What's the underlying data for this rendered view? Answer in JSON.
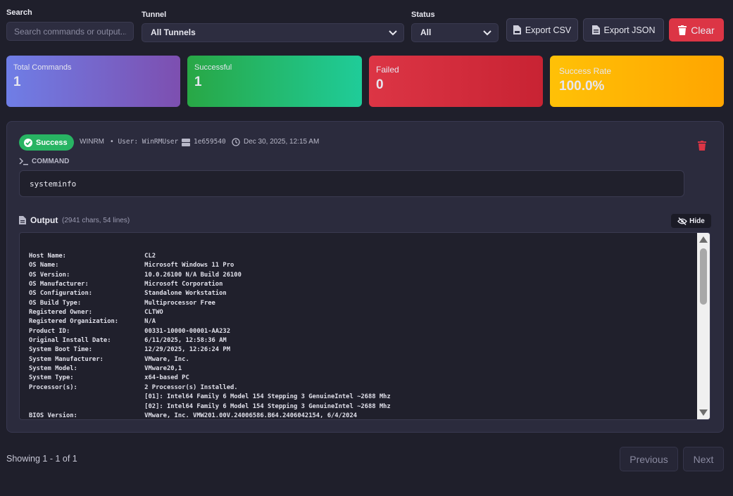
{
  "filters": {
    "search_label": "Search",
    "search_placeholder": "Search commands or output...",
    "tunnel_label": "Tunnel",
    "tunnel_value": "All Tunnels",
    "status_label": "Status",
    "status_value": "All"
  },
  "toolbar": {
    "export_csv": "Export CSV",
    "export_json": "Export JSON",
    "clear": "Clear"
  },
  "stats": [
    {
      "title": "Total Commands",
      "value": "1"
    },
    {
      "title": "Successful",
      "value": "1"
    },
    {
      "title": "Failed",
      "value": "0"
    },
    {
      "title": "Success Rate",
      "value": "100.0%"
    }
  ],
  "entry": {
    "status": "Success",
    "protocol": "WINRM",
    "user": "• User: WinRMUser",
    "tunnel_id": "1e659540",
    "timestamp": "Dec 30, 2025, 12:15 AM",
    "command_label": "COMMAND",
    "command": "systeminfo",
    "output_label": "Output",
    "output_meta": "(2941 chars, 54 lines)",
    "hide_label": "Hide",
    "output_text": "Host Name:                     CL2\nOS Name:                       Microsoft Windows 11 Pro\nOS Version:                    10.0.26100 N/A Build 26100\nOS Manufacturer:               Microsoft Corporation\nOS Configuration:              Standalone Workstation\nOS Build Type:                 Multiprocessor Free\nRegistered Owner:              CLTWO\nRegistered Organization:       N/A\nProduct ID:                    00331-10000-00001-AA232\nOriginal Install Date:         6/11/2025, 12:58:36 AM\nSystem Boot Time:              12/29/2025, 12:26:24 PM\nSystem Manufacturer:           VMware, Inc.\nSystem Model:                  VMware20,1\nSystem Type:                   x64-based PC\nProcessor(s):                  2 Processor(s) Installed.\n                               [01]: Intel64 Family 6 Model 154 Stepping 3 GenuineIntel ~2688 Mhz\n                               [02]: Intel64 Family 6 Model 154 Stepping 3 GenuineIntel ~2688 Mhz\nBIOS Version:                  VMware, Inc. VMW201.00V.24006586.B64.2406042154, 6/4/2024"
  },
  "pagination": {
    "summary": "Showing 1 - 1 of 1",
    "previous": "Previous",
    "next": "Next"
  },
  "colors": {
    "background": "#1f1f2b",
    "success": "#28b463",
    "danger": "#dc3545",
    "warning": "#ffa500"
  }
}
